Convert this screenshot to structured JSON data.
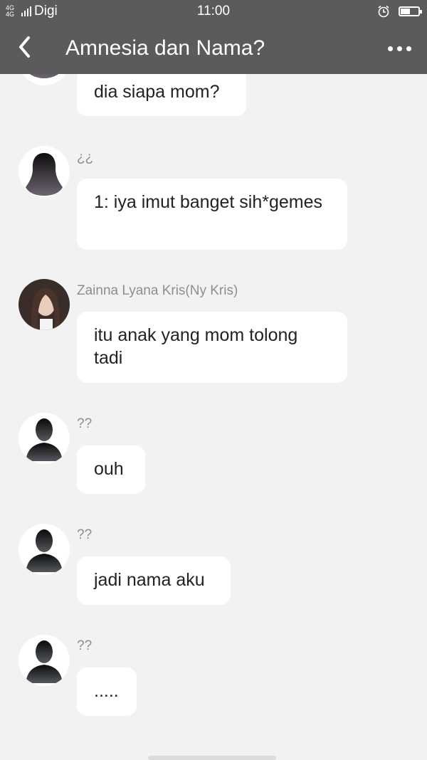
{
  "status_bar": {
    "network": "4G 4G",
    "carrier": "Digi",
    "time": "11:00",
    "battery_level": 0.55
  },
  "nav": {
    "title": "Amnesia dan Nama?"
  },
  "messages": [
    {
      "sender": "",
      "text": "dia siapa mom?",
      "avatar": "female-silhouette"
    },
    {
      "sender": "¿¿",
      "text": "1: iya imut banget sih*gemes",
      "avatar": "female-silhouette"
    },
    {
      "sender": "Zainna Lyana Kris(Ny Kris)",
      "text": "itu anak yang mom tolong tadi",
      "avatar": "female-photo"
    },
    {
      "sender": "??",
      "text": "ouh",
      "avatar": "male-silhouette"
    },
    {
      "sender": "??",
      "text": "jadi nama aku",
      "avatar": "male-silhouette"
    },
    {
      "sender": "??",
      "text": ".....",
      "avatar": "male-silhouette"
    }
  ],
  "colors": {
    "bar": "#5b5b5b",
    "background": "#f2f2f2",
    "bubble": "#ffffff",
    "sender": "#8e8e8e"
  }
}
